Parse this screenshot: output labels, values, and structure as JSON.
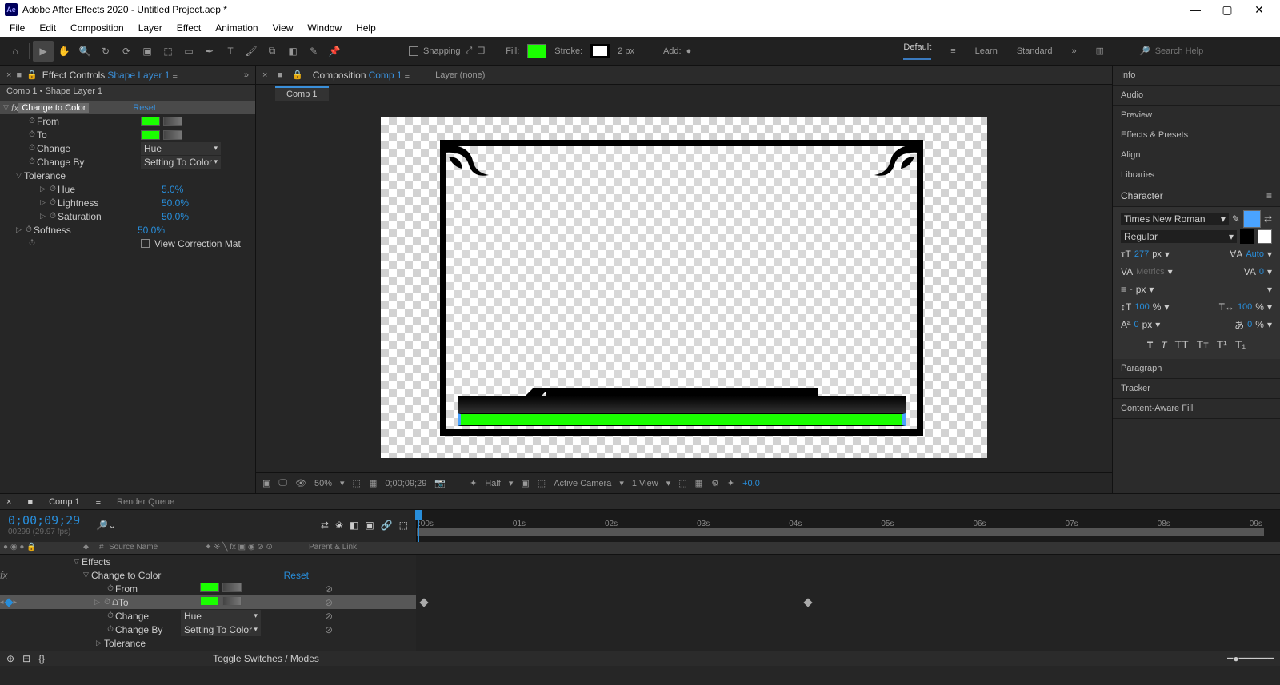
{
  "titlebar": {
    "app_icon": "Ae",
    "title": "Adobe After Effects 2020 - Untitled Project.aep *"
  },
  "menu": [
    "File",
    "Edit",
    "Composition",
    "Layer",
    "Effect",
    "Animation",
    "View",
    "Window",
    "Help"
  ],
  "toolbar": {
    "snapping": "Snapping",
    "fill": "Fill:",
    "stroke": "Stroke:",
    "stroke_px": "2  px",
    "add": "Add:",
    "workspaces": [
      "Default",
      "Learn",
      "Standard"
    ],
    "search_placeholder": "Search Help"
  },
  "effects_panel": {
    "tab_prefix": "Effect Controls",
    "tab_layer": "Shape Layer 1",
    "crumb": "Comp 1 • Shape Layer 1",
    "fx_name": "Change to Color",
    "reset": "Reset",
    "props": {
      "from": "From",
      "to": "To",
      "change": "Change",
      "change_val": "Hue",
      "change_by": "Change By",
      "change_by_val": "Setting To Color",
      "tolerance": "Tolerance",
      "hue": "Hue",
      "hue_val": "5.0%",
      "lightness": "Lightness",
      "lightness_val": "50.0%",
      "saturation": "Saturation",
      "saturation_val": "50.0%",
      "softness": "Softness",
      "softness_val": "50.0%",
      "view_mat": "View Correction Mat"
    }
  },
  "comp_panel": {
    "tab_prefix": "Composition",
    "tab_name": "Comp 1",
    "layer_tab": "Layer  (none)",
    "inner_tab": "Comp 1"
  },
  "view_footer": {
    "zoom": "50%",
    "time": "0;00;09;29",
    "res": "Half",
    "camera": "Active Camera",
    "views": "1 View",
    "exp": "+0.0"
  },
  "right_panels": [
    "Info",
    "Audio",
    "Preview",
    "Effects & Presets",
    "Align",
    "Libraries"
  ],
  "character": {
    "title": "Character",
    "font": "Times New Roman",
    "style": "Regular",
    "size": "277",
    "size_unit": "px",
    "leading": "Auto",
    "kerning": "Metrics",
    "tracking": "0",
    "px": "px",
    "vscale": "100",
    "hscale": "100",
    "pct": "%",
    "baseline": "0",
    "tsume": "0"
  },
  "bottom_panels": [
    "Paragraph",
    "Tracker",
    "Content-Aware Fill"
  ],
  "timeline": {
    "tab": "Comp 1",
    "render_queue": "Render Queue",
    "timecode": "0;00;09;29",
    "frames": "00299 (29.97 fps)",
    "col_source": "Source Name",
    "col_parent": "Parent & Link",
    "markers": [
      ":00s",
      "01s",
      "02s",
      "03s",
      "04s",
      "05s",
      "06s",
      "07s",
      "08s",
      "09s"
    ],
    "rows": {
      "effects": "Effects",
      "fx": "Change to Color",
      "fx_reset": "Reset",
      "from": "From",
      "to": "To",
      "change": "Change",
      "change_val": "Hue",
      "change_by": "Change By",
      "change_by_val": "Setting To Color",
      "tolerance": "Tolerance"
    },
    "toggle": "Toggle Switches / Modes"
  }
}
